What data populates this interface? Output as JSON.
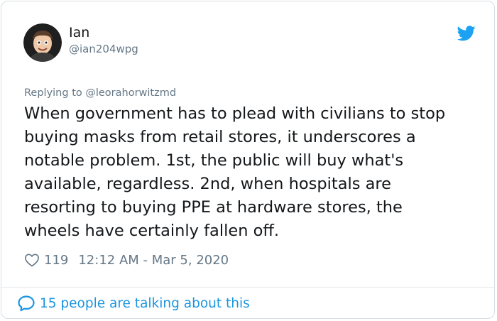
{
  "author": {
    "name": "Ian",
    "handle": "@ian204wpg",
    "avatar_icon": "cartoon-avatar-icon"
  },
  "reply": {
    "text": "Replying to @leorahorwitzmd"
  },
  "tweet": {
    "lines": [
      "When government has to plead with civilians to stop",
      "buying masks from retail stores, it underscores a",
      "notable problem. 1st, the public will buy what's",
      "available, regardless. 2nd, when hospitals are",
      "resorting to buying PPE at hardware stores, the",
      "wheels have certainly fallen off."
    ]
  },
  "meta": {
    "likes": "119",
    "timestamp": "12:12 AM - Mar 5, 2020"
  },
  "footer": {
    "talking": "15 people are talking about this"
  },
  "colors": {
    "brand": "#1da1f2",
    "link": "#1b95e0",
    "secondary": "#657786",
    "text": "#14171a"
  }
}
